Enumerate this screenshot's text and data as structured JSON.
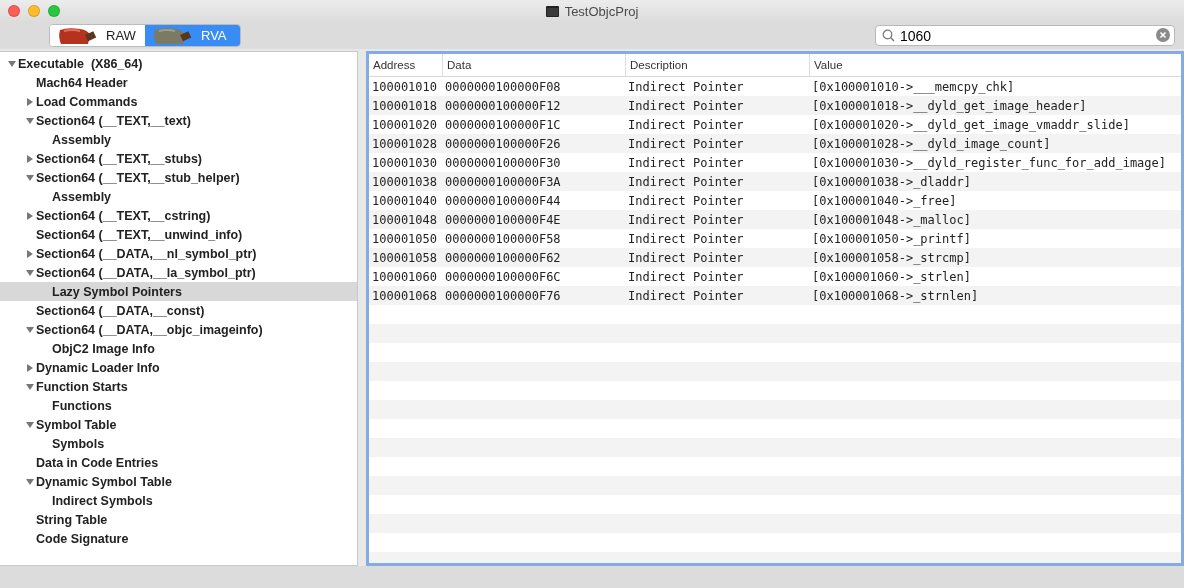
{
  "window": {
    "title": "TestObjcProj"
  },
  "view_modes": [
    {
      "label": "RAW",
      "selected": false
    },
    {
      "label": "RVA",
      "selected": true
    }
  ],
  "search": {
    "value": "1060"
  },
  "tree": [
    {
      "label": "Executable  (X86_64)",
      "expanded": true,
      "selected": false,
      "children": [
        {
          "label": "Mach64 Header",
          "selected": false
        },
        {
          "label": "Load Commands",
          "expanded": false,
          "selected": false
        },
        {
          "label": "Section64 (__TEXT,__text)",
          "expanded": true,
          "selected": false,
          "children": [
            {
              "label": "Assembly",
              "selected": false
            }
          ]
        },
        {
          "label": "Section64 (__TEXT,__stubs)",
          "expanded": false,
          "selected": false
        },
        {
          "label": "Section64 (__TEXT,__stub_helper)",
          "expanded": true,
          "selected": false,
          "children": [
            {
              "label": "Assembly",
              "selected": false
            }
          ]
        },
        {
          "label": "Section64 (__TEXT,__cstring)",
          "expanded": false,
          "selected": false
        },
        {
          "label": "Section64 (__TEXT,__unwind_info)",
          "selected": false
        },
        {
          "label": "Section64 (__DATA,__nl_symbol_ptr)",
          "expanded": false,
          "selected": false
        },
        {
          "label": "Section64 (__DATA,__la_symbol_ptr)",
          "expanded": true,
          "selected": false,
          "children": [
            {
              "label": "Lazy Symbol Pointers",
              "selected": true
            }
          ]
        },
        {
          "label": "Section64 (__DATA,__const)",
          "selected": false
        },
        {
          "label": "Section64 (__DATA,__objc_imageinfo)",
          "expanded": true,
          "selected": false,
          "children": [
            {
              "label": "ObjC2 Image Info",
              "selected": false
            }
          ]
        },
        {
          "label": "Dynamic Loader Info",
          "expanded": false,
          "selected": false
        },
        {
          "label": "Function Starts",
          "expanded": true,
          "selected": false,
          "children": [
            {
              "label": "Functions",
              "selected": false
            }
          ]
        },
        {
          "label": "Symbol Table",
          "expanded": true,
          "selected": false,
          "children": [
            {
              "label": "Symbols",
              "selected": false
            }
          ]
        },
        {
          "label": "Data in Code Entries",
          "selected": false
        },
        {
          "label": "Dynamic Symbol Table",
          "expanded": true,
          "selected": false,
          "children": [
            {
              "label": "Indirect Symbols",
              "selected": false
            }
          ]
        },
        {
          "label": "String Table",
          "selected": false
        },
        {
          "label": "Code Signature",
          "selected": false
        }
      ]
    }
  ],
  "table": {
    "columns": [
      "Address",
      "Data",
      "Description",
      "Value"
    ],
    "rows": [
      [
        "100001010",
        "0000000100000F08",
        "Indirect Pointer",
        "[0x100001010->___memcpy_chk]"
      ],
      [
        "100001018",
        "0000000100000F12",
        "Indirect Pointer",
        "[0x100001018->__dyld_get_image_header]"
      ],
      [
        "100001020",
        "0000000100000F1C",
        "Indirect Pointer",
        "[0x100001020->__dyld_get_image_vmaddr_slide]"
      ],
      [
        "100001028",
        "0000000100000F26",
        "Indirect Pointer",
        "[0x100001028->__dyld_image_count]"
      ],
      [
        "100001030",
        "0000000100000F30",
        "Indirect Pointer",
        "[0x100001030->__dyld_register_func_for_add_image]"
      ],
      [
        "100001038",
        "0000000100000F3A",
        "Indirect Pointer",
        "[0x100001038->_dladdr]"
      ],
      [
        "100001040",
        "0000000100000F44",
        "Indirect Pointer",
        "[0x100001040->_free]"
      ],
      [
        "100001048",
        "0000000100000F4E",
        "Indirect Pointer",
        "[0x100001048->_malloc]"
      ],
      [
        "100001050",
        "0000000100000F58",
        "Indirect Pointer",
        "[0x100001050->_printf]"
      ],
      [
        "100001058",
        "0000000100000F62",
        "Indirect Pointer",
        "[0x100001058->_strcmp]"
      ],
      [
        "100001060",
        "0000000100000F6C",
        "Indirect Pointer",
        "[0x100001060->_strlen]"
      ],
      [
        "100001068",
        "0000000100000F76",
        "Indirect Pointer",
        "[0x100001068->_strnlen]"
      ]
    ]
  }
}
